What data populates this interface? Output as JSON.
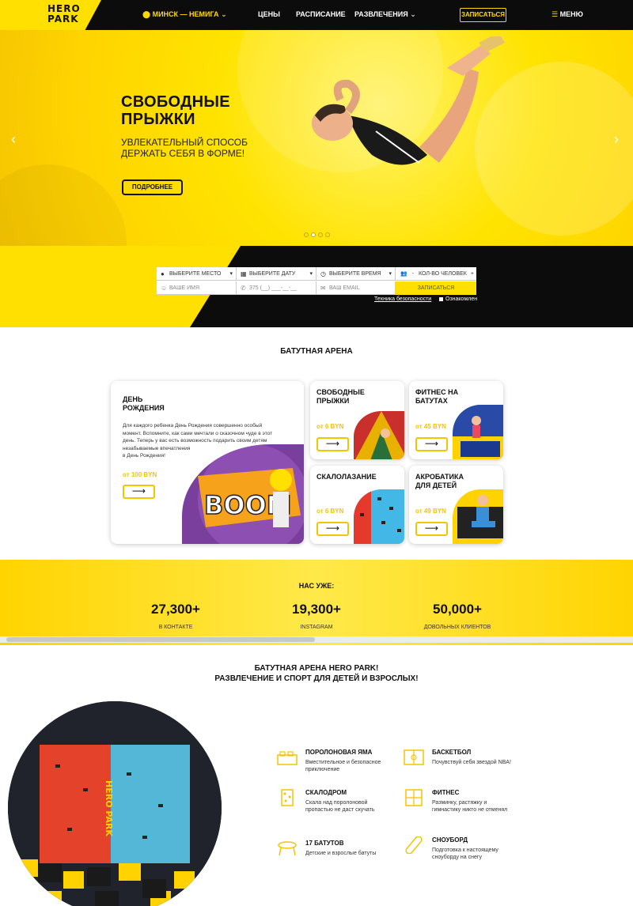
{
  "header": {
    "logo_line1": "HERO",
    "logo_line2": "PARK",
    "city": "МИНСК — НЕМИГА",
    "nav": [
      "ЦЕНЫ",
      "РАСПИСАНИЕ",
      "РАЗВЛЕЧЕНИЯ"
    ],
    "cta": "ЗАПИСАТЬСЯ",
    "menu": "МЕНЮ"
  },
  "hero": {
    "title_line1": "СВОБОДНЫЕ",
    "title_line2": "ПРЫЖКИ",
    "subtitle_line1": "УВЛЕКАТЕЛЬНЫЙ СПОСОБ",
    "subtitle_line2": "ДЕРЖАТЬ СЕБЯ В ФОРМЕ!",
    "button": "ПОДРОБНЕЕ",
    "slide_count": 4,
    "active_slide": 2
  },
  "booking": {
    "place": "ВЫБЕРИТЕ МЕСТО",
    "date": "ВЫБЕРИТЕ ДАТУ",
    "time": "ВЫБЕРИТЕ ВРЕМЯ",
    "people_minus": "-",
    "people": "КОЛ-ВО ЧЕЛОВЕК",
    "people_plus": "+",
    "name_placeholder": "ВАШЕ ИМЯ",
    "phone_placeholder": "375 (__) ___-__-__",
    "email_placeholder": "ВАШ EMAIL",
    "submit": "ЗАПИСАТЬСЯ",
    "safety_link": "Техника безопасности",
    "agree": "Ознакомлен"
  },
  "arena": {
    "title": "БАТУТНАЯ АРЕНА",
    "cards": [
      {
        "title_l1": "ДЕНЬ",
        "title_l2": "РОЖДЕНИЯ",
        "price": "от 100 BYN",
        "desc": [
          "Для каждого ребенка День Рождения совершенно особый",
          "момент. Вспомните, как сами мечтали о сказочном чуде в этот",
          "день. Теперь у вас есть возможность подарить своим детям",
          "незабываемые впечатления",
          "в День Рождения!"
        ],
        "pic_text": "BOOM"
      },
      {
        "title_l1": "СВОБОДНЫЕ",
        "title_l2": "ПРЫЖКИ",
        "price": "от 6 BYN"
      },
      {
        "title_l1": "ФИТНЕС НА",
        "title_l2": "БАТУТАХ",
        "price": "от 45 BYN"
      },
      {
        "title_l1": "СКАЛОЛАЗАНИЕ",
        "title_l2": "",
        "price": "от 6 BYN"
      },
      {
        "title_l1": "АКРОБАТИКА",
        "title_l2": "ДЛЯ ДЕТЕЙ",
        "price": "от 49 BYN"
      }
    ],
    "arrow": "⟶"
  },
  "stats": {
    "title": "НАС УЖЕ:",
    "items": [
      {
        "num": "27,300+",
        "label": "В КОНТАКТЕ"
      },
      {
        "num": "19,300+",
        "label": "INSTAGRAM"
      },
      {
        "num": "50,000+",
        "label": "ДОВОЛЬНЫХ КЛИЕНТОВ"
      }
    ]
  },
  "about": {
    "title_line1": "БАТУТНАЯ АРЕНА HERO PARK!",
    "title_line2": "РАЗВЛЕЧЕНИЕ И СПОРТ ДЛЯ ДЕТЕЙ И ВЗРОСЛЫХ!",
    "wall_text": "HERO PARK",
    "features": [
      {
        "title": "ПОРОЛОНОВАЯ ЯМА",
        "text": "Вместительное и безопасное приключение"
      },
      {
        "title": "БАСКЕТБОЛ",
        "text": "Почувствуй себя звездой NBA!"
      },
      {
        "title": "СКАЛОДРОМ",
        "text": "Скала над поролоновой пропастью не даст скучать"
      },
      {
        "title": "ФИТНЕС",
        "text": "Разминку, растяжку и гимнастику никто не отменял"
      },
      {
        "title": "17 БАТУТОВ",
        "text": "Детские и взрослые батуты"
      },
      {
        "title": "СНОУБОРД",
        "text": "Подготовка к настоящему сноуборду на снегу"
      }
    ]
  },
  "colors": {
    "accent": "#ffe000",
    "dark": "#0c0c0c",
    "price": "#f5c400"
  }
}
